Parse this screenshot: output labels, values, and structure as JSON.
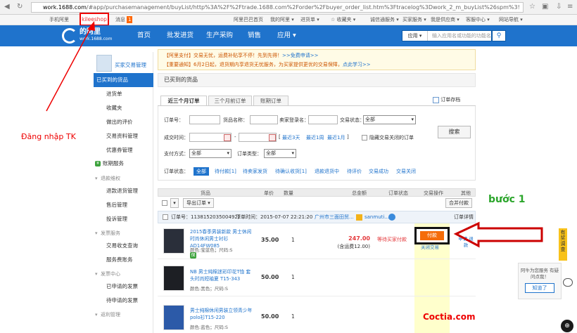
{
  "browser": {
    "url_host": "work.1688.com",
    "url_path": "/#app/purchasemanagement/buyList/http%3A%2F%2Ftrade.1688.com%2Forder%2Fbuyer_order_list.htm%3Ftracelog%3Dwork_2_m_buyList%26spm%3!"
  },
  "topbar": {
    "mobile": "手机阿里",
    "user": "kileeshop",
    "messages": "消息",
    "msg_count": "1",
    "links": [
      "阿里巴巴首页",
      "我的阿里 ▾",
      "进货单 ▾",
      "☆ 收藏夹 ▾",
      "诚信通服务 ▾",
      "买家服务 ▾",
      "我是供应商 ▾",
      "客服中心 ▾",
      "网站导航 ▾"
    ]
  },
  "header": {
    "logo_title": "的阿里",
    "logo_sub": "work.1688.com",
    "nav": [
      "首页",
      "批发进货",
      "生产采购",
      "销售",
      "应用 ▾"
    ],
    "search_scope": "应用 ▾",
    "search_placeholder": "输入应用名或功能的功能名"
  },
  "sidebar": {
    "title": "买家交易管理",
    "items": [
      "已买到的货品",
      "进货单",
      "收藏夹",
      "做出的评价",
      "交易资料管理",
      "优惠券管理"
    ],
    "green_item": "账期服务",
    "groups": [
      {
        "title": "退款维权",
        "items": [
          "退款退货管理",
          "售后管理",
          "投诉管理"
        ]
      },
      {
        "title": "发票服务",
        "items": [
          "交易收支查询",
          "服务费账务"
        ]
      },
      {
        "title": "发票中心",
        "items": [
          "已申请的发票",
          "待申请的发票"
        ]
      },
      {
        "title": "返利管理",
        "items": []
      }
    ]
  },
  "notice": {
    "line1": "【阿里支付】交易无忧，运费补贴享不停！先到先得！",
    "line1_link": ">>免费申请>>",
    "line2": "【重要通知】6月2日起，退货期内享退货无忧服务，为买家提供更优的交易保障，",
    "line2_link": "点此学习>>"
  },
  "page_title": "已买到的货品",
  "tabs": [
    "近三个月订单",
    "三个月前订单",
    "账期订单"
  ],
  "order_recycle": "订单存档",
  "filter": {
    "order_no": "订单号：",
    "product_name": "货品名称：",
    "seller_login": "卖家登录名：",
    "trade_status": "交易状态：",
    "trade_status_value": "全部",
    "success_time": "成交时间：",
    "recent_3": "最近3天",
    "recent_week": "最近1周",
    "recent_month": "最近1月",
    "hide_closed": "隐藏交易关闭的订单",
    "pay_method": "支付方式：",
    "pay_method_value": "全部",
    "order_type": "订单类型：",
    "order_type_value": "全部",
    "search": "搜索"
  },
  "status_row": {
    "label": "订单状态：",
    "items": [
      "全部",
      "待付款[1]",
      "待卖家发货",
      "待确认收货[1]",
      "退款退货中",
      "待评价",
      "交易成功",
      "交易关闭"
    ]
  },
  "table_headers": [
    "货品",
    "单价",
    "数量",
    "总金额",
    "订单状态",
    "交易操作",
    "其他"
  ],
  "toolbar": {
    "export": "导出订单 ▾",
    "merge_pay": "合并付款"
  },
  "order": {
    "order_no": "订单号：1138152035004922",
    "order_time": "下单时间：2015-07-07 22:21:20",
    "seller": "广州市三面田贸...",
    "seller_name": "sanmuti...",
    "detail": "订单详情",
    "total": "247.00",
    "shipping": "(含运费12.00)",
    "status": "等待买家付款",
    "pay_button": "付款",
    "sub_link": "关闭交易",
    "apply_refund": "申请 退款",
    "items": [
      {
        "name": "2015春季男装新款 男士休闲时尚休闲男士衬衫AD14FW085",
        "attr": "颜色:宝蓝色；尺码:S",
        "price": "35.00",
        "qty": "1"
      },
      {
        "name": "NB 男士纯棉迷彩印花T恤 套头时尚短袖夏 T15-343",
        "attr": "颜色:黑色；尺码:S",
        "price": "50.00",
        "qty": "1"
      },
      {
        "name": "男士纯棉休闲男装立领青少年polo衫T15-220",
        "attr": "颜色:蓝色；尺码:S",
        "price": "50.00",
        "qty": "1"
      }
    ]
  },
  "annotations": {
    "login": "Đăng nhập TK",
    "step": "bước 1",
    "watermark": "Coctia.com"
  },
  "side": {
    "chat_text": "阿牛为您服务 有疑问点我！",
    "chat_button": "知道了",
    "feedback": "有奖调查"
  }
}
